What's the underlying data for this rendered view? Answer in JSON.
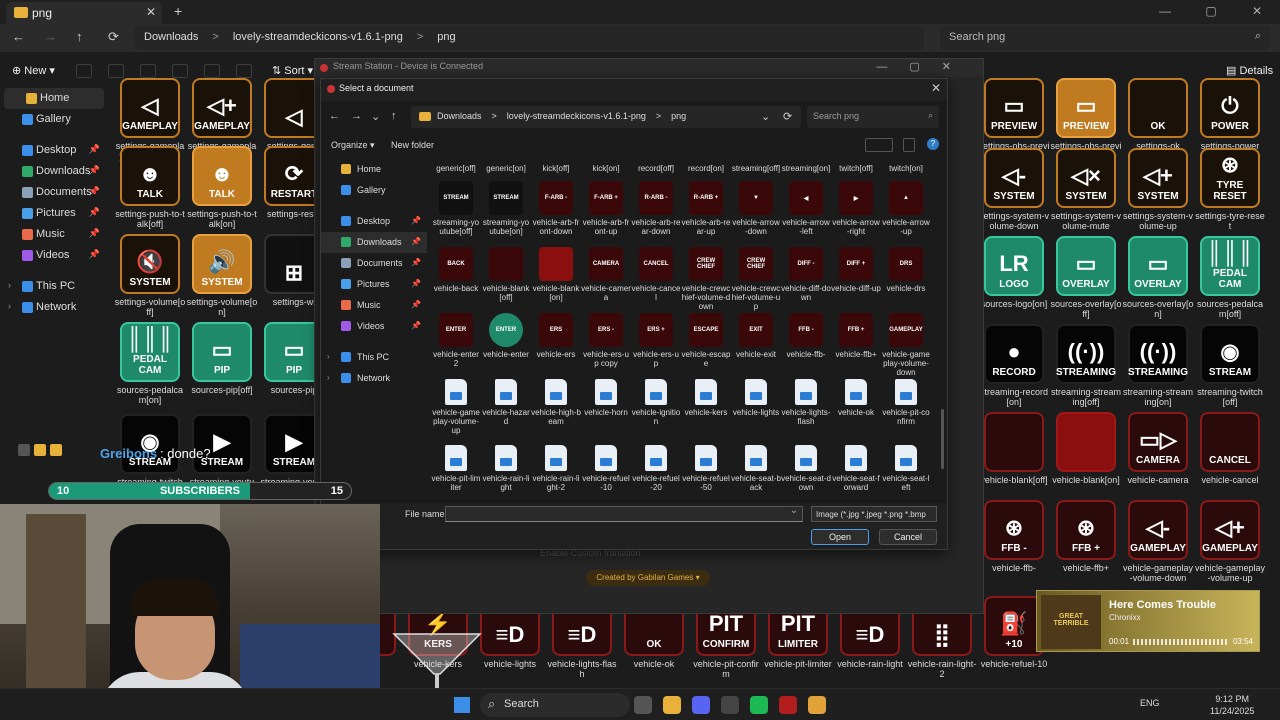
{
  "explorer": {
    "tab_title": "png",
    "breadcrumbs": [
      "Downloads",
      ">",
      "lovely-streamdeckicons-v1.6.1-png",
      ">",
      "png"
    ],
    "search_placeholder": "Search png",
    "new_label": "New",
    "sort_label": "Sort",
    "details_label": "Details",
    "sidebar": [
      {
        "label": "Home",
        "color": "#e8b23a",
        "selected": true
      },
      {
        "label": "Gallery",
        "color": "#3b8fe8"
      },
      {
        "label": "Desktop",
        "color": "#3b8fe8",
        "pinned": true
      },
      {
        "label": "Downloads",
        "color": "#2faa6a",
        "pinned": true
      },
      {
        "label": "Documents",
        "color": "#8aa0b8",
        "pinned": true
      },
      {
        "label": "Pictures",
        "color": "#4aa0e8",
        "pinned": true
      },
      {
        "label": "Music",
        "color": "#e86a4a",
        "pinned": true
      },
      {
        "label": "Videos",
        "color": "#a05ae8",
        "pinned": true
      },
      {
        "label": "This PC",
        "color": "#3b8fe8",
        "expandable": true
      },
      {
        "label": "Network",
        "color": "#3b8fe8",
        "expandable": true
      }
    ],
    "left_tiles": [
      {
        "text": "GAMEPLAY",
        "glyph": "◁",
        "style": "t-darkorange",
        "name": "settings-gameplay-volume-down"
      },
      {
        "text": "GAMEPLAY",
        "glyph": "◁+",
        "style": "t-darkorange",
        "name": "settings-gameplay-volume-up"
      },
      {
        "text": "",
        "glyph": "◁",
        "style": "t-darkorange",
        "name": "settings-gene"
      },
      {
        "text": "TALK",
        "glyph": "☻",
        "style": "t-darkorange",
        "name": "settings-push-to-talk[off]"
      },
      {
        "text": "TALK",
        "glyph": "☻",
        "style": "t-orange",
        "name": "settings-push-to-talk[on]"
      },
      {
        "text": "RESTART",
        "glyph": "⟳",
        "style": "t-darkorange",
        "name": "settings-resta"
      },
      {
        "text": "SYSTEM",
        "glyph": "🔇",
        "style": "t-darkorange",
        "name": "settings-volume[off]"
      },
      {
        "text": "SYSTEM",
        "glyph": "🔊",
        "style": "t-orange",
        "name": "settings-volume[on]"
      },
      {
        "text": "",
        "glyph": "⊞",
        "style": "t-dark",
        "name": "settings-wi"
      },
      {
        "text": "PEDAL CAM",
        "glyph": "║║║",
        "style": "t-green",
        "name": "sources-pedalcam[on]"
      },
      {
        "text": "PIP",
        "glyph": "▭",
        "style": "t-green",
        "name": "sources-pip[off]"
      },
      {
        "text": "PIP",
        "glyph": "▭",
        "style": "t-green",
        "name": "sources-pip"
      },
      {
        "text": "STREAM",
        "glyph": "◉",
        "style": "t-black",
        "name": "streaming-twitch"
      },
      {
        "text": "STREAM",
        "glyph": "▶",
        "style": "t-black",
        "name": "streaming-youtu"
      },
      {
        "text": "STREAM",
        "glyph": "▶",
        "style": "t-black",
        "name": "streaming-yoube[on]"
      }
    ],
    "right_tiles": [
      {
        "text": "PREVIEW",
        "glyph": "▭",
        "style": "t-darkorange",
        "name": "settings-obs-preview[off]"
      },
      {
        "text": "PREVIEW",
        "glyph": "▭",
        "style": "t-orange",
        "name": "settings-obs-preview[on]"
      },
      {
        "text": "OK",
        "glyph": "",
        "style": "t-darkorange",
        "name": "settings-ok"
      },
      {
        "text": "POWER",
        "glyph": "⏻",
        "style": "t-darkorange",
        "name": "settings-power"
      },
      {
        "text": "SYSTEM",
        "glyph": "◁-",
        "style": "t-darkorange",
        "name": "settings-system-volume-down"
      },
      {
        "text": "SYSTEM",
        "glyph": "◁×",
        "style": "t-darkorange",
        "name": "settings-system-volume-mute"
      },
      {
        "text": "SYSTEM",
        "glyph": "◁+",
        "style": "t-darkorange",
        "name": "settings-system-volume-up"
      },
      {
        "text": "TYRE RESET",
        "glyph": "⊛",
        "style": "t-darkorange",
        "name": "settings-tyre-reset"
      },
      {
        "text": "LOGO",
        "glyph": "LR",
        "style": "t-green",
        "name": "sources-logo[on]"
      },
      {
        "text": "OVERLAY",
        "glyph": "▭",
        "style": "t-green",
        "name": "sources-overlay[off]"
      },
      {
        "text": "OVERLAY",
        "glyph": "▭",
        "style": "t-green",
        "name": "sources-overlay[on]"
      },
      {
        "text": "PEDAL CAM",
        "glyph": "║║║",
        "style": "t-green",
        "name": "sources-pedalcam[off]"
      },
      {
        "text": "RECORD",
        "glyph": "●",
        "style": "t-black",
        "name": "streaming-record[on]"
      },
      {
        "text": "STREAMING",
        "glyph": "((·))",
        "style": "t-black",
        "name": "streaming-streaming[off]"
      },
      {
        "text": "STREAMING",
        "glyph": "((·))",
        "style": "t-black",
        "name": "streaming-streaming[on]"
      },
      {
        "text": "STREAM",
        "glyph": "◉",
        "style": "t-black",
        "name": "streaming-twitch[off]"
      },
      {
        "text": "",
        "glyph": "",
        "style": "t-red",
        "name": "vehicle-blank[off]"
      },
      {
        "text": "",
        "glyph": "",
        "style": "t-redfill",
        "name": "vehicle-blank[on]"
      },
      {
        "text": "CAMERA",
        "glyph": "▭▷",
        "style": "t-red",
        "name": "vehicle-camera"
      },
      {
        "text": "CANCEL",
        "glyph": "",
        "style": "t-red",
        "name": "vehicle-cancel"
      },
      {
        "text": "FFB -",
        "glyph": "⊛",
        "style": "t-red",
        "name": "vehicle-ffb-"
      },
      {
        "text": "FFB +",
        "glyph": "⊛",
        "style": "t-red",
        "name": "vehicle-ffb+"
      },
      {
        "text": "GAMEPLAY",
        "glyph": "◁-",
        "style": "t-red",
        "name": "vehicle-gameplay-volume-down"
      },
      {
        "text": "GAMEPLAY",
        "glyph": "◁+",
        "style": "t-red",
        "name": "vehicle-gameplay-volume-up"
      }
    ],
    "bottom_tiles": [
      {
        "text": "",
        "glyph": "",
        "name": "tion"
      },
      {
        "text": "KERS",
        "glyph": "⚡",
        "name": "vehicle-kers"
      },
      {
        "text": "",
        "glyph": "≡D",
        "name": "vehicle-lights"
      },
      {
        "text": "",
        "glyph": "≡D",
        "name": "vehicle-lights-flash"
      },
      {
        "text": "OK",
        "glyph": "",
        "name": "vehicle-ok"
      },
      {
        "text": "CONFIRM",
        "glyph": "PIT",
        "name": "vehicle-pit-confirm"
      },
      {
        "text": "LIMITER",
        "glyph": "PIT",
        "name": "vehicle-pit-limiter"
      },
      {
        "text": "",
        "glyph": "≡D",
        "name": "vehicle-rain-light"
      },
      {
        "text": "",
        "glyph": "⣿",
        "name": "vehicle-rain-light-2"
      },
      {
        "text": "+10",
        "glyph": "⛽",
        "name": "vehicle-refuel-10"
      }
    ]
  },
  "stream_station": {
    "title": "Stream Station - Device is Connected",
    "custom_transition": "Enable Custom transition",
    "created_by": "Created by Gabilan Games"
  },
  "dialog": {
    "title": "Select a document",
    "breadcrumbs": [
      "Downloads",
      ">",
      "lovely-streamdeckicons-v1.6.1-png",
      ">",
      "png"
    ],
    "search_placeholder": "Search png",
    "organize_label": "Organize ▾",
    "new_folder_label": "New folder",
    "sidebar": [
      {
        "label": "Home",
        "color": "#e8b23a"
      },
      {
        "label": "Gallery",
        "color": "#3b8fe8"
      },
      {
        "label": "Desktop",
        "color": "#3b8fe8",
        "pinned": true
      },
      {
        "label": "Downloads",
        "color": "#2faa6a",
        "pinned": true,
        "selected": true
      },
      {
        "label": "Documents",
        "color": "#8aa0b8",
        "pinned": true
      },
      {
        "label": "Pictures",
        "color": "#4aa0e8",
        "pinned": true
      },
      {
        "label": "Music",
        "color": "#e86a4a",
        "pinned": true
      },
      {
        "label": "Videos",
        "color": "#a05ae8",
        "pinned": true
      },
      {
        "label": "This PC",
        "color": "#3b8fe8",
        "expandable": true
      },
      {
        "label": "Network",
        "color": "#3b8fe8",
        "expandable": true
      }
    ],
    "top_labels": [
      "generic[off]",
      "generic[on]",
      "kick[off]",
      "kick[on]",
      "record[off]",
      "record[on]",
      "streaming[off]",
      "streaming[on]",
      "twitch[off]",
      "twitch[on]"
    ],
    "files": [
      {
        "label": "streaming-youtube[off]",
        "thumb": "STREAM",
        "kind": "dark"
      },
      {
        "label": "streaming-youtube[on]",
        "thumb": "STREAM",
        "kind": "dark"
      },
      {
        "label": "vehicle-arb-front-down",
        "thumb": "F-ARB -",
        "kind": "red"
      },
      {
        "label": "vehicle-arb-front-up",
        "thumb": "F-ARB +",
        "kind": "red"
      },
      {
        "label": "vehicle-arb-rear-down",
        "thumb": "R-ARB -",
        "kind": "red"
      },
      {
        "label": "vehicle-arb-rear-up",
        "thumb": "R-ARB +",
        "kind": "red"
      },
      {
        "label": "vehicle-arrow-down",
        "thumb": "▼",
        "kind": "red"
      },
      {
        "label": "vehicle-arrow-left",
        "thumb": "◀",
        "kind": "red"
      },
      {
        "label": "vehicle-arrow-right",
        "thumb": "▶",
        "kind": "red"
      },
      {
        "label": "vehicle-arrow-up",
        "thumb": "▲",
        "kind": "red"
      },
      {
        "label": "vehicle-back",
        "thumb": "BACK",
        "kind": "red"
      },
      {
        "label": "vehicle-blank[off]",
        "thumb": "",
        "kind": "red"
      },
      {
        "label": "vehicle-blank[on]",
        "thumb": "",
        "kind": "redfill"
      },
      {
        "label": "vehicle-camera",
        "thumb": "CAMERA",
        "kind": "red"
      },
      {
        "label": "vehicle-cancel",
        "thumb": "CANCEL",
        "kind": "red"
      },
      {
        "label": "vehicle-crewchief-volume-down",
        "thumb": "CREW CHIEF",
        "kind": "red"
      },
      {
        "label": "vehicle-crewchief-volume-up",
        "thumb": "CREW CHIEF",
        "kind": "red"
      },
      {
        "label": "vehicle-diff-down",
        "thumb": "DIFF -",
        "kind": "red"
      },
      {
        "label": "vehicle-diff-up",
        "thumb": "DIFF +",
        "kind": "red"
      },
      {
        "label": "vehicle-drs",
        "thumb": "DRS",
        "kind": "red"
      },
      {
        "label": "vehicle-enter 2",
        "thumb": "ENTER",
        "kind": "red"
      },
      {
        "label": "vehicle-enter",
        "thumb": "ENTER",
        "kind": "green"
      },
      {
        "label": "vehicle-ers",
        "thumb": "ERS",
        "kind": "red"
      },
      {
        "label": "vehicle-ers-up copy",
        "thumb": "ERS -",
        "kind": "red"
      },
      {
        "label": "vehicle-ers-up",
        "thumb": "ERS +",
        "kind": "red"
      },
      {
        "label": "vehicle-escape",
        "thumb": "ESCAPE",
        "kind": "red"
      },
      {
        "label": "vehicle-exit",
        "thumb": "EXIT",
        "kind": "red"
      },
      {
        "label": "vehicle-ffb-",
        "thumb": "FFB -",
        "kind": "red"
      },
      {
        "label": "vehicle-ffb+",
        "thumb": "FFB +",
        "kind": "red"
      },
      {
        "label": "vehicle-gameplay-volume-down",
        "thumb": "GAMEPLAY",
        "kind": "red"
      },
      {
        "label": "vehicle-gameplay-volume-up",
        "thumb": "",
        "kind": "img"
      },
      {
        "label": "vehicle-hazard",
        "thumb": "",
        "kind": "img"
      },
      {
        "label": "vehicle-high-beam",
        "thumb": "",
        "kind": "img"
      },
      {
        "label": "vehicle-horn",
        "thumb": "",
        "kind": "img"
      },
      {
        "label": "vehicle-ignition",
        "thumb": "",
        "kind": "img"
      },
      {
        "label": "vehicle-kers",
        "thumb": "",
        "kind": "img"
      },
      {
        "label": "vehicle-lights",
        "thumb": "",
        "kind": "img"
      },
      {
        "label": "vehicle-lights-flash",
        "thumb": "",
        "kind": "img"
      },
      {
        "label": "vehicle-ok",
        "thumb": "",
        "kind": "img"
      },
      {
        "label": "vehicle-pit-confirm",
        "thumb": "",
        "kind": "img"
      },
      {
        "label": "vehicle-pit-limiter",
        "thumb": "",
        "kind": "img"
      },
      {
        "label": "vehicle-rain-light",
        "thumb": "",
        "kind": "img"
      },
      {
        "label": "vehicle-rain-light-2",
        "thumb": "",
        "kind": "img"
      },
      {
        "label": "vehicle-refuel-10",
        "thumb": "",
        "kind": "img"
      },
      {
        "label": "vehicle-refuel-20",
        "thumb": "",
        "kind": "img"
      },
      {
        "label": "vehicle-refuel-50",
        "thumb": "",
        "kind": "img"
      },
      {
        "label": "vehicle-seat-back",
        "thumb": "",
        "kind": "img"
      },
      {
        "label": "vehicle-seat-down",
        "thumb": "",
        "kind": "img"
      },
      {
        "label": "vehicle-seat-forward",
        "thumb": "",
        "kind": "img"
      },
      {
        "label": "vehicle-seat-left",
        "thumb": "",
        "kind": "img"
      }
    ],
    "file_name_label": "File name:",
    "file_name_value": "",
    "filter_value": "Image (*.jpg *.jpeg *.png *.bmp",
    "open_label": "Open",
    "cancel_label": "Cancel"
  },
  "overlay": {
    "chat_user": "Greibons",
    "chat_message": ": donde?",
    "subs_current": "10",
    "subs_label": "SUBSCRIBERS",
    "subs_goal": "15",
    "subs_progress": 0.667,
    "accent": "#1a9a78"
  },
  "music": {
    "title": "Here Comes Trouble",
    "artist": "Chronixx",
    "elapsed": "00:01",
    "duration": "03:54",
    "art_text": "GREAT TERRIBLE"
  },
  "taskbar": {
    "search_label": "Search",
    "lang": "ENG",
    "time": "9:12 PM",
    "date": "11/24/2025"
  }
}
